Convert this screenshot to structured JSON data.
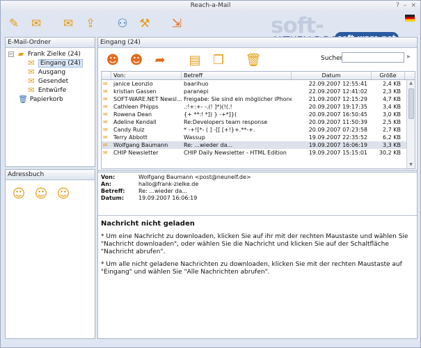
{
  "window": {
    "title": "Reach-a-Mail",
    "controls": [
      "?",
      "–",
      "×"
    ]
  },
  "watermark": {
    "main": "soft-ware.net",
    "sub": "AKTUELLE DOWNLOADS",
    "badge": "soft-ware.net",
    "badge_small": "download"
  },
  "toolbar": {
    "buttons": [
      {
        "name": "compose",
        "icon": "pencil-icon"
      },
      {
        "name": "check-mail",
        "icon": "mail-check-icon"
      },
      {
        "name": "reply",
        "icon": "reply-icon"
      },
      {
        "name": "send",
        "icon": "send-icon"
      },
      {
        "name": "find",
        "icon": "binoculars-icon"
      },
      {
        "name": "settings",
        "icon": "tools-icon"
      },
      {
        "name": "exit",
        "icon": "exit-icon"
      }
    ]
  },
  "folders": {
    "title": "E-Mail-Ordner",
    "account": "Frank Zielke (24)",
    "items": [
      {
        "label": "Eingang (24)",
        "selected": true
      },
      {
        "label": "Ausgang"
      },
      {
        "label": "Gesendet"
      },
      {
        "label": "Entwürfe"
      }
    ],
    "trash": "Papierkorb"
  },
  "addressbook": {
    "title": "Adressbuch"
  },
  "inbox": {
    "title": "Eingang (24)",
    "search_label": "Suchen",
    "search_value": "",
    "columns": [
      "Von:",
      "Betreff",
      "Datum",
      "Größe"
    ],
    "rows": [
      {
        "from": "janice Leonzio",
        "subject": "baarihuo",
        "date": "22.09.2007 12:55:41",
        "size": "2,4 KB"
      },
      {
        "from": "kristian Gassen",
        "subject": "paranepi",
        "date": "22.09.2007 12:41:02",
        "size": "2,3 KB"
      },
      {
        "from": "SOFT-WARE.NET Newsl...",
        "subject": "Freigabe: Sie sind ein möglicher iPhone...",
        "date": "21.09.2007 12:15:29",
        "size": "4,7 KB"
      },
      {
        "from": "Cathleen Phipps",
        "subject": ".:!+:+- -.(! ]*)(!(.!",
        "date": "20.09.2007 19:17:35",
        "size": "3,4 KB"
      },
      {
        "from": "Rowena Dean",
        "subject": "{+ **:!  *]) } -+*]}(",
        "date": "20.09.2007 16:50:45",
        "size": "3,0 KB"
      },
      {
        "from": "Adeline Kendall",
        "subject": "Re:Developers team response",
        "date": "20.09.2007 11:50:39",
        "size": "2,5 KB"
      },
      {
        "from": "Candy Ruiz",
        "subject": "*  -+![*- ( ]  -[[ [+!}+.**-+.",
        "date": "20.09.2007 07:23:58",
        "size": "2,7 KB"
      },
      {
        "from": "Terry Abbott",
        "subject": "Wassup",
        "date": "19.09.2007 22:35:52",
        "size": "6,2 KB"
      },
      {
        "from": "Wolfgang Baumann",
        "subject": "Re: ...wieder da...",
        "date": "19.09.2007 16:06:19",
        "size": "3,3 KB",
        "selected": true
      },
      {
        "from": "CHIP Newsletter",
        "subject": "CHIP Daily Newsletter - HTML Edition",
        "date": "19.09.2007 15:15:01",
        "size": "30,2 KB"
      }
    ]
  },
  "message": {
    "labels": {
      "from": "Von:",
      "to": "An:",
      "subject": "Betreff:",
      "date": "Datum:"
    },
    "from": "Wolfgang Baumann <post@neunelf.de>",
    "to": "hallo@frank-zielke.de",
    "subject": "Re: ...wieder da...",
    "date": "19.09.2007 16:06:19",
    "body_title": "Nachricht nicht geladen",
    "body_p1": "* Um eine Nachricht zu downloaden, klicken Sie auf ihr mit der rechten Maustaste und wählen Sie \"Nachricht downloaden\", oder wählen Sie die Nachricht und klicken Sie auf der Schaltfläche \"Nachricht abrufen\".",
    "body_p2": "* Um alle nicht geladene Nachrichten zu downloaden, klicken Sie mit der rechten Maustaste auf \"Eingang\" und wählen Sie \"Alle Nachrichten abrufen\"."
  }
}
